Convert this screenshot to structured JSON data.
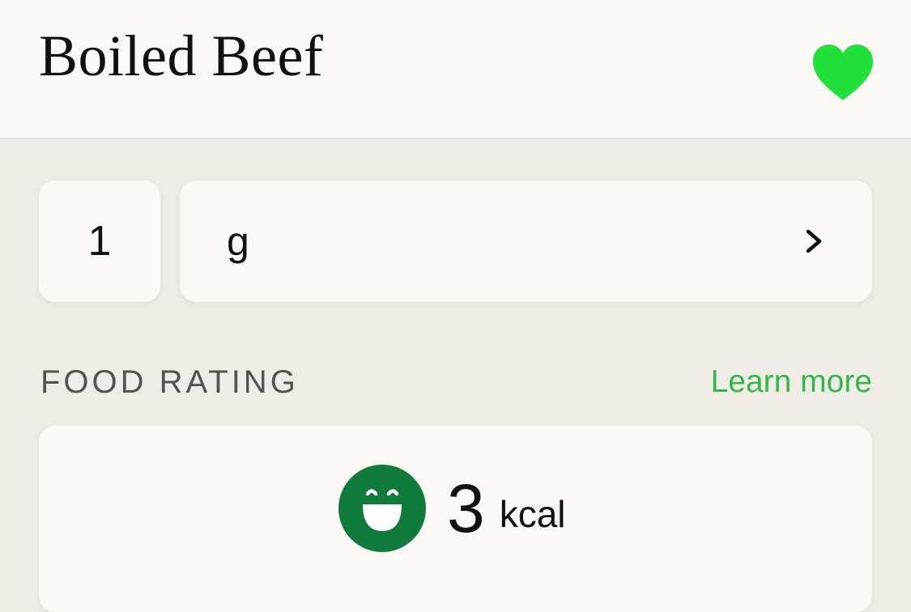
{
  "header": {
    "title": "Boiled Beef",
    "favorite_icon": "heart-icon",
    "favorite_color": "#22e03c"
  },
  "serving": {
    "quantity": "1",
    "unit": "g",
    "unit_chevron_icon": "chevron-right-icon"
  },
  "food_rating": {
    "section_title": "FOOD RATING",
    "learn_more_label": "Learn more",
    "rating_icon": "smiling-face-icon",
    "rating_color": "#0f7a3b",
    "kcal_value": "3",
    "kcal_unit": "kcal"
  },
  "colors": {
    "background": "#efebe6",
    "card": "#faf9f6",
    "accent_green": "#35b64a"
  }
}
